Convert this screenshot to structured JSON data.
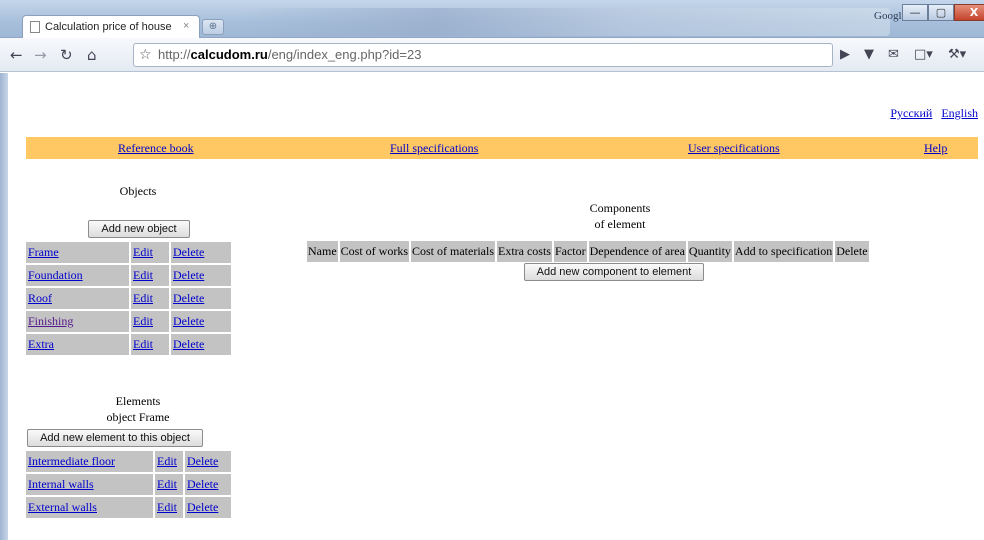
{
  "browser": {
    "search_provider": "Google",
    "tab_title": "Calculation price of house",
    "tab_close": "×",
    "new_tab": "⊕",
    "url_prefix": "http://",
    "url_host": "calcudom.ru",
    "url_path": "/eng/index_eng.php?id=23",
    "window_buttons": [
      "—",
      "▢",
      "X"
    ]
  },
  "languages": [
    "Русский",
    "English"
  ],
  "menu": [
    "Reference book",
    "Full specifications",
    "User specifications",
    "Help"
  ],
  "objects": {
    "title": "Objects",
    "add_button": "Add new object",
    "rows": [
      {
        "name": "Frame",
        "edit": "Edit",
        "delete": "Delete"
      },
      {
        "name": "Foundation",
        "edit": "Edit",
        "delete": "Delete"
      },
      {
        "name": "Roof",
        "edit": "Edit",
        "delete": "Delete"
      },
      {
        "name": "Finishing",
        "edit": "Edit",
        "delete": "Delete"
      },
      {
        "name": "Extra",
        "edit": "Edit",
        "delete": "Delete"
      }
    ]
  },
  "elements": {
    "title_line1": "Elements",
    "title_line2": "object Frame",
    "add_button": "Add new element to this object",
    "rows": [
      {
        "name": "Intermediate floor",
        "edit": "Edit",
        "delete": "Delete"
      },
      {
        "name": "Internal walls",
        "edit": "Edit",
        "delete": "Delete"
      },
      {
        "name": "External walls",
        "edit": "Edit",
        "delete": "Delete"
      }
    ]
  },
  "components": {
    "title_line1": "Components",
    "title_line2": "of element",
    "columns": [
      "Name",
      "Cost of works",
      "Cost of materials",
      "Extra costs",
      "Factor",
      "Dependence of area",
      "Quantity",
      "Add to specification",
      "Delete"
    ],
    "add_button": "Add new component to element"
  }
}
